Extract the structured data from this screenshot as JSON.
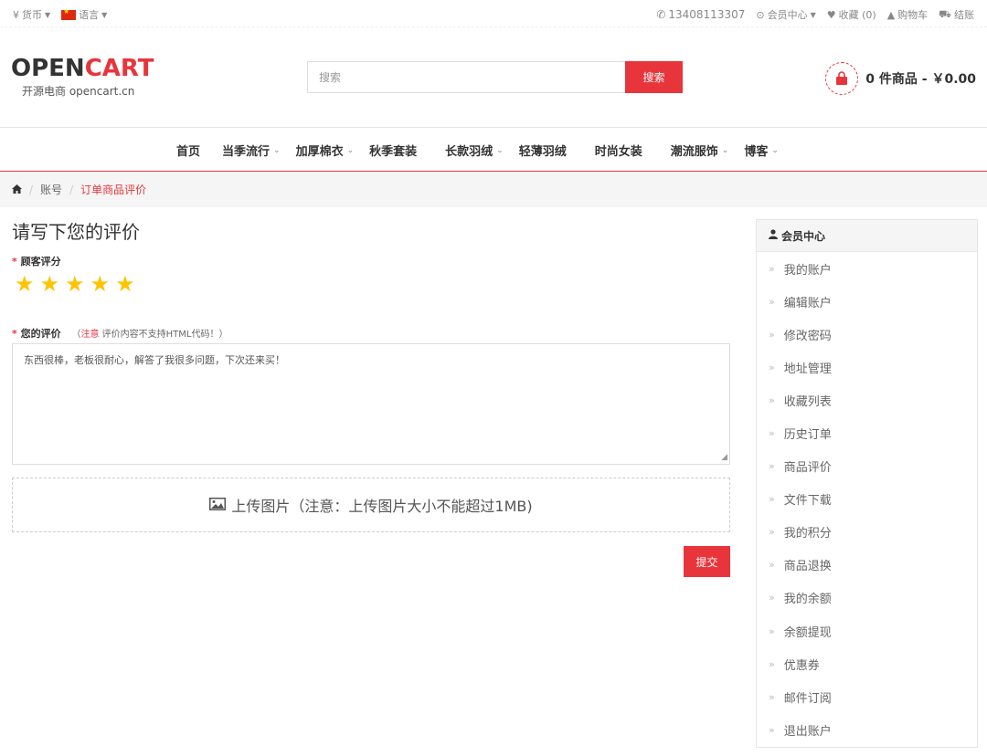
{
  "topbar": {
    "currency_label": "货币",
    "language_label": "语言",
    "phone": "13408113307",
    "account_label": "会员中心",
    "wishlist_label": "收藏 (0)",
    "cart_label": "购物车",
    "checkout_label": "结账"
  },
  "header": {
    "logo_open": "OPEN",
    "logo_cart": "CART",
    "logo_sub": "开源电商 opencart.cn",
    "search_placeholder": "搜索",
    "search_button": "搜索",
    "cart_summary": "0 件商品 - ￥0.00"
  },
  "nav": {
    "items": [
      {
        "label": "首页",
        "dropdown": false
      },
      {
        "label": "当季流行",
        "dropdown": true
      },
      {
        "label": "加厚棉衣",
        "dropdown": true
      },
      {
        "label": "秋季套装",
        "dropdown": false
      },
      {
        "label": "长款羽绒",
        "dropdown": true
      },
      {
        "label": "轻薄羽绒",
        "dropdown": false
      },
      {
        "label": "时尚女装",
        "dropdown": false
      },
      {
        "label": "潮流服饰",
        "dropdown": true
      },
      {
        "label": "博客",
        "dropdown": true
      }
    ]
  },
  "breadcrumb": {
    "items": [
      "账号",
      "订单商品评价"
    ]
  },
  "main": {
    "title": "请写下您的评价",
    "rating_label": "顾客评分",
    "rating_value": 5,
    "rating_max": 5,
    "review_label": "您的评价",
    "note_warn": "注意",
    "note_text": "评价内容不支持HTML代码！）",
    "note_open": "（",
    "review_text": "东西很棒，老板很耐心，解答了我很多问题，下次还来买！",
    "upload_label": "上传图片（注意：上传图片大小不能超过1MB)",
    "submit_label": "提交"
  },
  "sidebar": {
    "title": "会员中心",
    "items": [
      "我的账户",
      "编辑账户",
      "修改密码",
      "地址管理",
      "收藏列表",
      "历史订单",
      "商品评价",
      "文件下载",
      "我的积分",
      "商品退换",
      "我的余额",
      "余额提现",
      "优惠券",
      "邮件订阅",
      "退出账户"
    ]
  },
  "colors": {
    "accent": "#e8353b",
    "star": "#ffc400"
  }
}
